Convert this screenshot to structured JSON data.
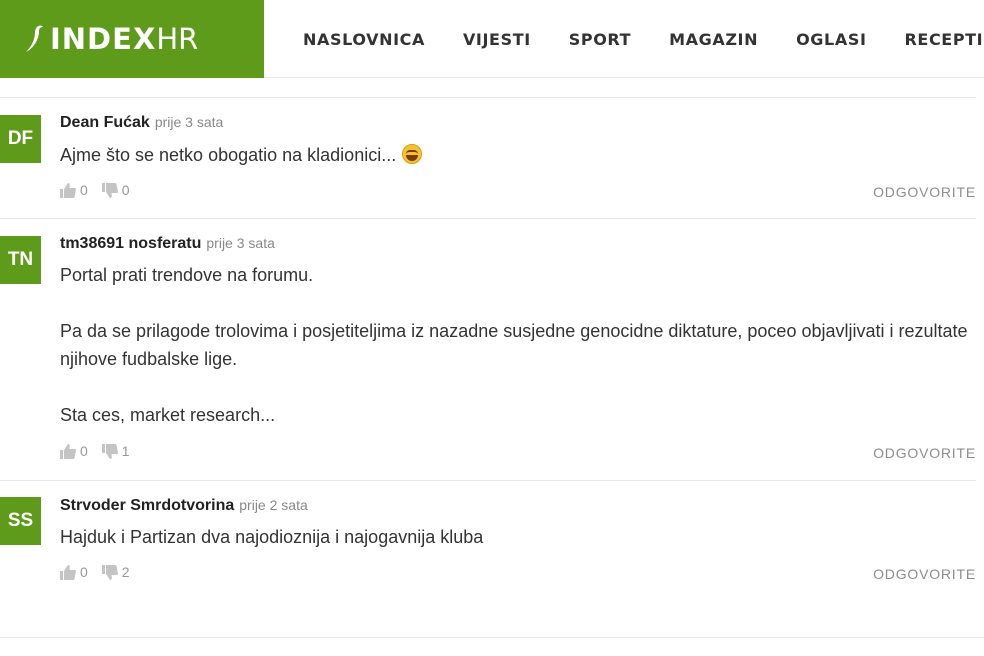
{
  "header": {
    "logo_text": "INDEX",
    "logo_suffix": "HR",
    "nav": [
      "NASLOVNICA",
      "VIJESTI",
      "SPORT",
      "MAGAZIN",
      "OGLASI",
      "RECEPTI"
    ]
  },
  "colors": {
    "brand": "#5e9b1b",
    "muted": "#888888"
  },
  "comments": [
    {
      "initials": "DF",
      "author": "Dean Fućak",
      "time": "prije 3 sata",
      "text": "Ajme što se netko obogatio na kladionici...",
      "emoji": "laughing-tears-emoji",
      "likes": "0",
      "dislikes": "0",
      "reply_label": "ODGOVORITE"
    },
    {
      "initials": "TN",
      "author": "tm38691 nosferatu",
      "time": "prije 3 sata",
      "paragraphs": [
        "Portal prati trendove na forumu.",
        "Pa da se prilagode trolovima i posjetiteljima iz nazadne susjedne genocidne diktature, poceo objavljivati i rezultate njihove fudbalske lige.",
        "Sta ces, market research..."
      ],
      "likes": "0",
      "dislikes": "1",
      "reply_label": "ODGOVORITE"
    },
    {
      "initials": "SS",
      "author": "Strvoder Smrdotvorina",
      "time": "prije 2 sata",
      "text": "Hajduk i Partizan dva najodioznija i najogavnija kluba",
      "likes": "0",
      "dislikes": "2",
      "reply_label": "ODGOVORITE"
    }
  ]
}
